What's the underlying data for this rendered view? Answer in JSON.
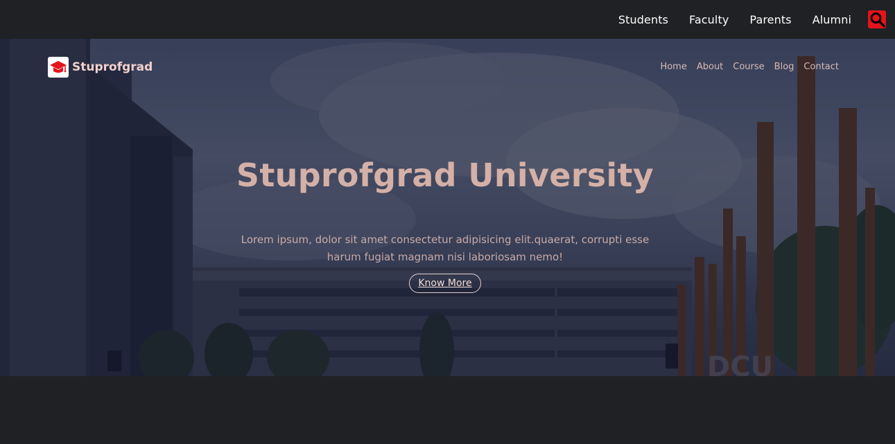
{
  "topnav": {
    "items": [
      {
        "label": "Students"
      },
      {
        "label": "Faculty"
      },
      {
        "label": "Parents"
      },
      {
        "label": "Alumni"
      }
    ],
    "search_icon": "search-icon",
    "accent": "#e3141b"
  },
  "header": {
    "brand_name": "Stuprofgrad",
    "logo_icon": "graduation-cap-icon",
    "nav": [
      {
        "label": "Home"
      },
      {
        "label": "About"
      },
      {
        "label": "Course"
      },
      {
        "label": "Blog"
      },
      {
        "label": "Contact"
      }
    ]
  },
  "hero": {
    "title": "Stuprofgrad University",
    "description": "Lorem ipsum, dolor sit amet consectetur adipisicing elit.quaerat, corrupti esse harum fugiat magnam nisi laboriosam nemo!",
    "button_label": "Know More",
    "title_color": "#d4b0a6"
  },
  "colors": {
    "page_background": "#202124",
    "overlay": "#12162c"
  }
}
